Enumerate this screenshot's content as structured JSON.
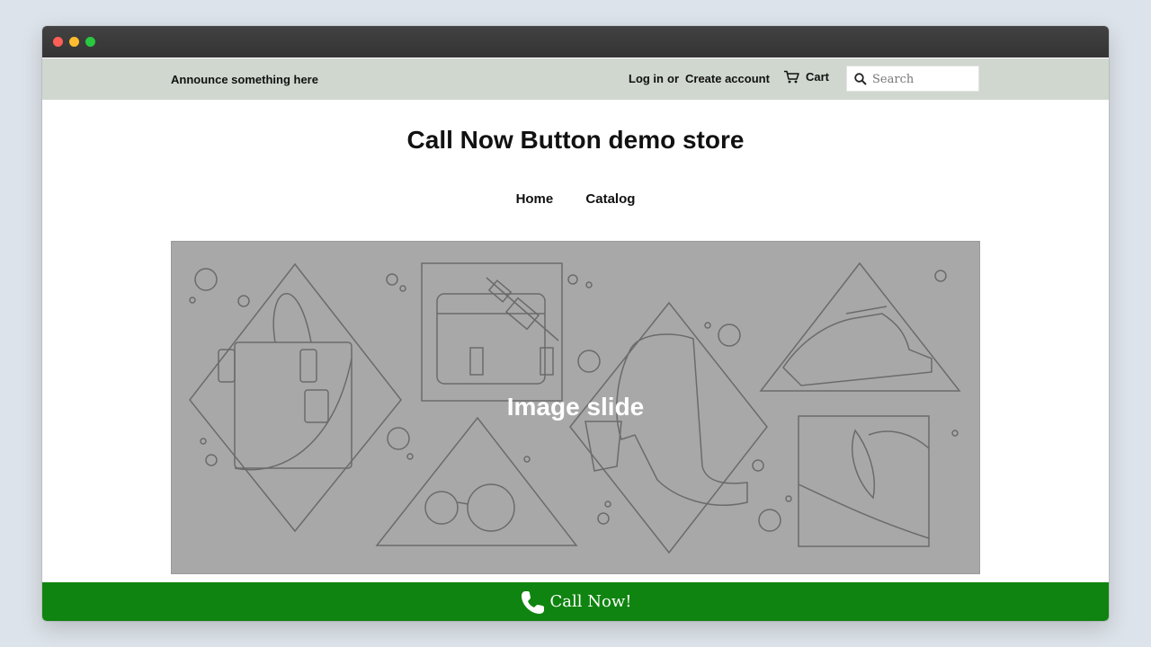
{
  "topbar": {
    "announcement": "Announce something here",
    "login": "Log in",
    "or": "or",
    "create_account": "Create account",
    "cart": "Cart",
    "search_placeholder": "Search"
  },
  "header": {
    "store_title": "Call Now Button demo store"
  },
  "nav": {
    "items": [
      {
        "label": "Home"
      },
      {
        "label": "Catalog"
      }
    ]
  },
  "slideshow": {
    "slide_label": "Image slide"
  },
  "call_bar": {
    "label": "Call Now!",
    "icon": "phone-icon"
  },
  "colors": {
    "topbar_bg": "#cfd7cf",
    "call_bar_bg": "#0f8410",
    "slide_bg": "#a8a8a8"
  }
}
